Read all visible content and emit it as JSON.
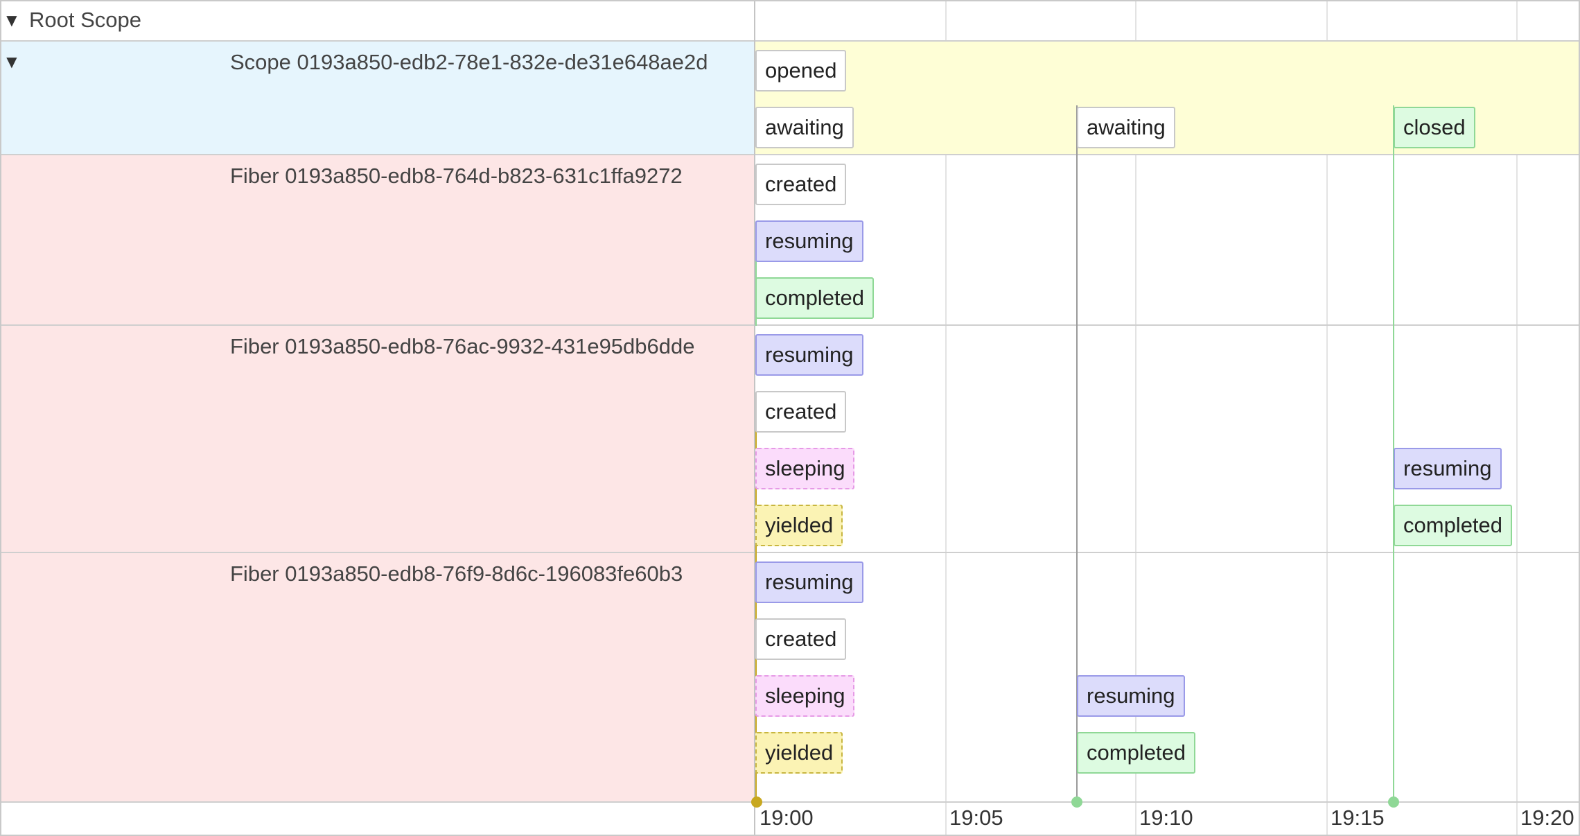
{
  "tree": {
    "root_label": "Root Scope",
    "scope_label": "Scope 0193a850-edb2-78e1-832e-de31e648ae2d",
    "fibers": [
      {
        "label": "Fiber 0193a850-edb8-764d-b823-631c1ffa9272"
      },
      {
        "label": "Fiber 0193a850-edb8-76ac-9932-431e95db6dde"
      },
      {
        "label": "Fiber 0193a850-edb8-76f9-8d6c-196083fe60b3"
      }
    ]
  },
  "timeline": {
    "ticks": [
      "19:00",
      "19:05",
      "19:10",
      "19:15",
      "19:20"
    ],
    "scope_events": [
      {
        "label": "opened",
        "kind": "opened",
        "time": "19:00"
      },
      {
        "label": "awaiting",
        "kind": "awaiting",
        "time": "19:00"
      },
      {
        "label": "awaiting",
        "kind": "awaiting",
        "time": "19:08.5"
      },
      {
        "label": "closed",
        "kind": "closed",
        "time": "19:17"
      }
    ],
    "fiber1_events": [
      {
        "label": "created",
        "kind": "created",
        "time": "19:00"
      },
      {
        "label": "resuming",
        "kind": "resuming",
        "time": "19:00"
      },
      {
        "label": "completed",
        "kind": "completed",
        "time": "19:00"
      }
    ],
    "fiber2_events": [
      {
        "label": "resuming",
        "kind": "resuming",
        "time": "19:00"
      },
      {
        "label": "created",
        "kind": "created",
        "time": "19:00"
      },
      {
        "label": "sleeping",
        "kind": "sleeping",
        "time": "19:00"
      },
      {
        "label": "yielded",
        "kind": "yielded",
        "time": "19:00"
      },
      {
        "label": "resuming",
        "kind": "resuming",
        "time": "19:17"
      },
      {
        "label": "completed",
        "kind": "completed",
        "time": "19:17"
      }
    ],
    "fiber3_events": [
      {
        "label": "resuming",
        "kind": "resuming",
        "time": "19:00"
      },
      {
        "label": "created",
        "kind": "created",
        "time": "19:00"
      },
      {
        "label": "sleeping",
        "kind": "sleeping",
        "time": "19:00"
      },
      {
        "label": "yielded",
        "kind": "yielded",
        "time": "19:00"
      },
      {
        "label": "resuming",
        "kind": "resuming",
        "time": "19:08.5"
      },
      {
        "label": "completed",
        "kind": "completed",
        "time": "19:08.5"
      }
    ]
  },
  "colors": {
    "scope_row_bg": "#e6f5fd",
    "scope_timeline_bg": "#fefed6",
    "fiber_row_bg": "#fde6e6",
    "resuming": "#dcdcfb",
    "completed": "#ddfbe1",
    "sleeping": "#fbdcfb",
    "yielded": "#fbf3b4",
    "connector_green": "#8fd896",
    "connector_yellow": "#c8a820"
  }
}
